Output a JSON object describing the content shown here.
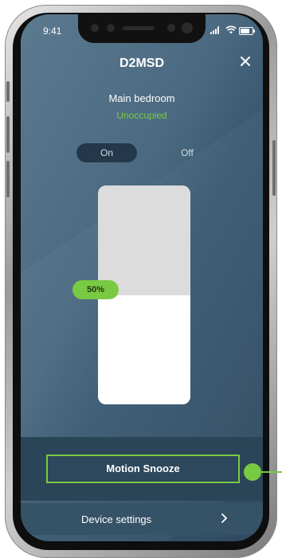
{
  "status_bar": {
    "time": "9:41"
  },
  "header": {
    "title": "D2MSD",
    "close_icon": "close-icon"
  },
  "room": {
    "name": "Main bedroom",
    "occupancy": "Unoccupied"
  },
  "toggle": {
    "on_label": "On",
    "off_label": "Off",
    "selected": "On"
  },
  "dimmer": {
    "level_percent": 50,
    "level_label": "50%"
  },
  "actions": {
    "motion_snooze": "Motion Snooze"
  },
  "settings": {
    "label": "Device settings",
    "chevron_icon": "chevron-right-icon"
  },
  "colors": {
    "accent": "#7ac943",
    "background": "#2f4a60"
  }
}
